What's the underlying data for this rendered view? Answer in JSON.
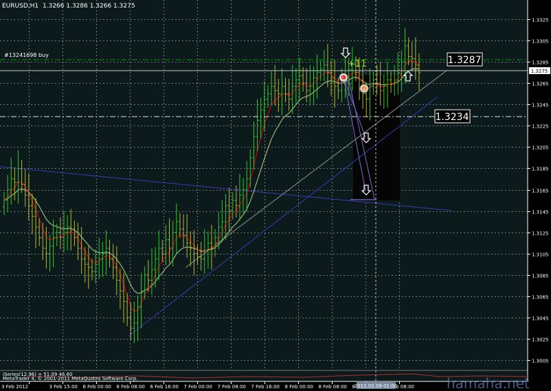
{
  "header": {
    "symbol": "EURUSD,H1",
    "ohlc": "1.3266 1.3286 1.3266 1.3275"
  },
  "order_label": "#13241698 buy",
  "profit_text": "+11",
  "price_tags": {
    "order_line": "1.3287",
    "current": "1.3275",
    "support": "1.3234"
  },
  "trade_markers": {
    "close": "C",
    "open": "4"
  },
  "indicator_label": "iSeries(12,96) = 51.09 46.60",
  "copyright": "MetaTrader 4, © 2001-2011 MetaQuotes Software Corp.",
  "cursor_time": "2012.02.09 01:00",
  "watermark": "hamaha.net",
  "colors": {
    "background": "#0c1a1c",
    "grid": "#c8c8c8",
    "ma_fast": "#c80000",
    "ma_slow": "#9ab878",
    "trend_line": "#4040c0",
    "order_line": "#00a000",
    "bull": "#32c832",
    "bear": "#b8b830"
  },
  "chart_data": {
    "type": "candlestick",
    "symbol": "EURUSD",
    "timeframe": "H1",
    "ylim": [
      1.3005,
      1.3325
    ],
    "y_ticks": [
      "1.3325",
      "1.3305",
      "1.3285",
      "1.3265",
      "1.3245",
      "1.3225",
      "1.3205",
      "1.3185",
      "1.3165",
      "1.3145",
      "1.3125",
      "1.3105",
      "1.3085",
      "1.3065",
      "1.3045",
      "1.3025",
      "1.3005"
    ],
    "x_ticks": [
      "3 Feb 2012",
      "3 Feb 15:00",
      "6 Feb 00:00",
      "6 Feb 08:00",
      "6 Feb 16:00",
      "7 Feb 00:00",
      "7 Feb 08:00",
      "7 Feb 16:00",
      "8 Feb 00:00",
      "8 Feb 08:00",
      "8 Feb 16:00",
      "9 Feb 08:00"
    ],
    "horizontal_levels": {
      "order": 1.3287,
      "current": 1.3275,
      "support": 1.3234
    },
    "closes": [
      1.3155,
      1.3165,
      1.3175,
      1.3172,
      1.3185,
      1.317,
      1.316,
      1.315,
      1.314,
      1.313,
      1.312,
      1.311,
      1.3105,
      1.3112,
      1.312,
      1.3125,
      1.312,
      1.3125,
      1.313,
      1.3128,
      1.312,
      1.311,
      1.31,
      1.3095,
      1.3092,
      1.3088,
      1.3095,
      1.31,
      1.3105,
      1.311,
      1.31,
      1.3092,
      1.308,
      1.307,
      1.306,
      1.3045,
      1.3035,
      1.304,
      1.3055,
      1.307,
      1.3085,
      1.308,
      1.309,
      1.31,
      1.311,
      1.3105,
      1.3118,
      1.311,
      1.3125,
      1.3135,
      1.3128,
      1.3122,
      1.3115,
      1.311,
      1.3105,
      1.3102,
      1.31,
      1.3108,
      1.3115,
      1.311,
      1.312,
      1.313,
      1.3135,
      1.315,
      1.3145,
      1.3155,
      1.315,
      1.316,
      1.3165,
      1.3175,
      1.3195,
      1.3215,
      1.323,
      1.324,
      1.325,
      1.3255,
      1.3262,
      1.3258,
      1.3255,
      1.3262,
      1.3255,
      1.325,
      1.3262,
      1.3268,
      1.3272,
      1.3265,
      1.3258,
      1.3262,
      1.327,
      1.3275,
      1.3278,
      1.3282,
      1.3275,
      1.327,
      1.3262,
      1.3258,
      1.3265,
      1.327,
      1.3278,
      1.3282,
      1.3275,
      1.326,
      1.3255,
      1.325,
      1.3262,
      1.3268,
      1.3265,
      1.3258,
      1.3262,
      1.3268,
      1.3264,
      1.3268,
      1.3274,
      1.3285,
      1.33,
      1.329,
      1.3288,
      1.3282,
      1.3275
    ]
  }
}
